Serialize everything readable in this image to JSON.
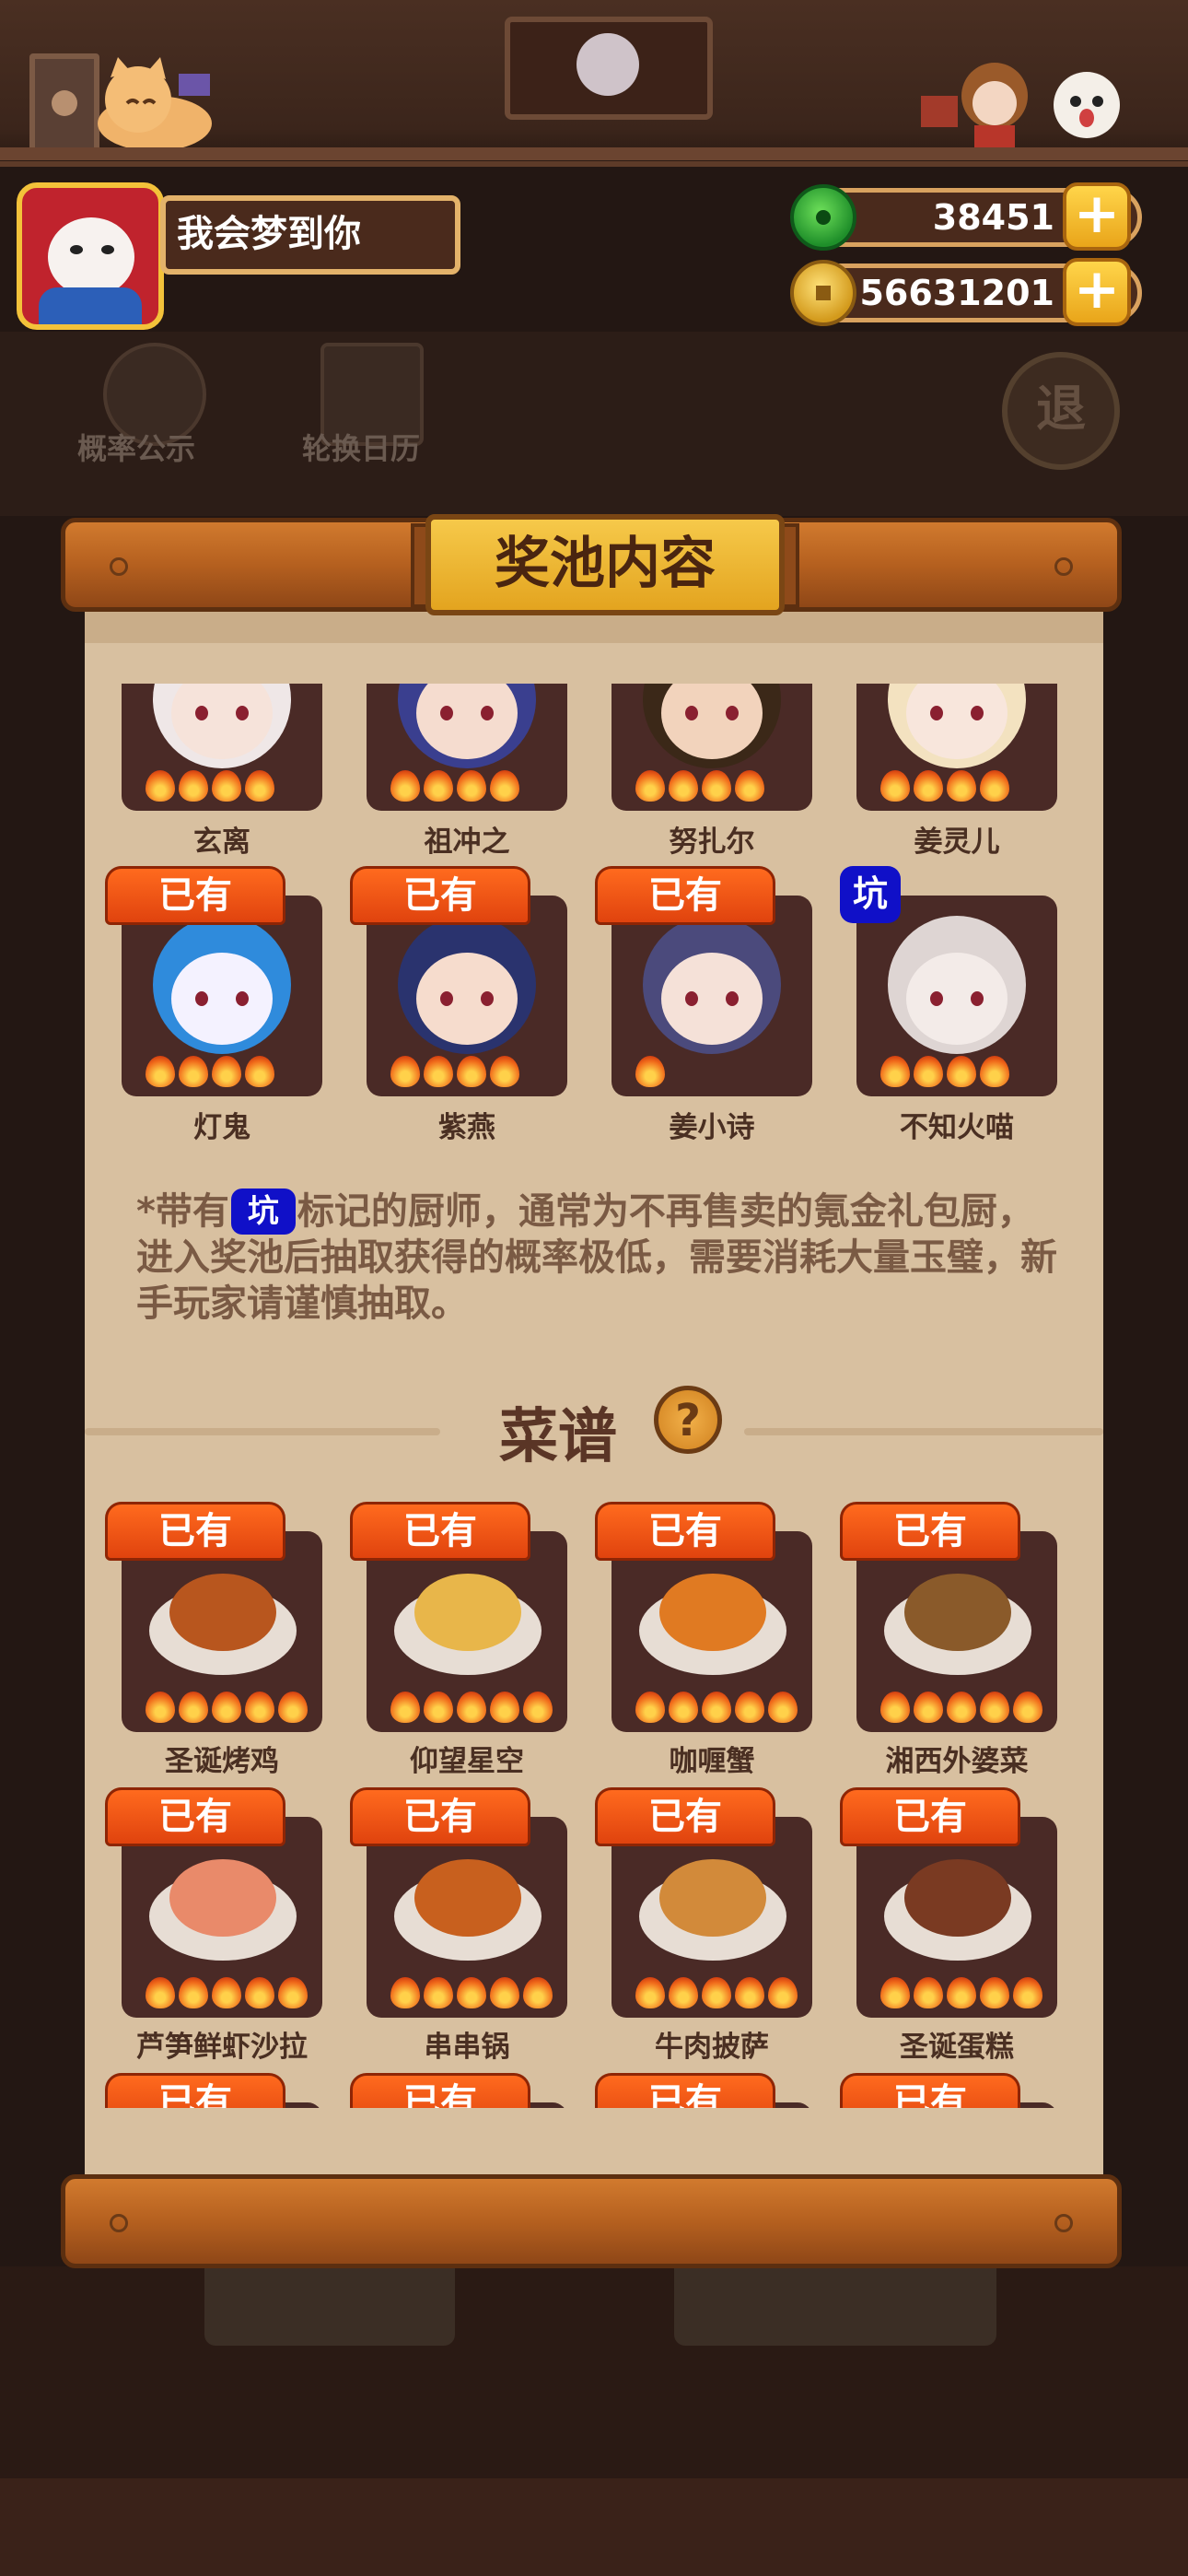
{
  "header": {
    "player_name": "我会梦到你",
    "jade": "38451",
    "gold": "56631201",
    "plus": "+"
  },
  "background": {
    "prob_label": "概率公示",
    "rotation_label": "轮换日历",
    "exit_label": "退"
  },
  "panel": {
    "title": "奖池内容"
  },
  "chefs": [
    {
      "name": "玄离",
      "owned": false,
      "pit": false,
      "stars": 4,
      "hair": "#efe7e7",
      "skin": "#f6e3da"
    },
    {
      "name": "祖冲之",
      "owned": false,
      "pit": false,
      "stars": 4,
      "hair": "#3a3f8f",
      "skin": "#f5dccf"
    },
    {
      "name": "努扎尔",
      "owned": false,
      "pit": false,
      "stars": 4,
      "hair": "#3b2818",
      "skin": "#f2d3bc"
    },
    {
      "name": "姜灵儿",
      "owned": false,
      "pit": false,
      "stars": 4,
      "hair": "#f3e2c0",
      "skin": "#f8e6dc"
    },
    {
      "name": "灯鬼",
      "owned": true,
      "pit": false,
      "stars": 4,
      "hair": "#2f8bdc",
      "skin": "#f4f2ff"
    },
    {
      "name": "紫燕",
      "owned": true,
      "pit": false,
      "stars": 4,
      "hair": "#2a336e",
      "skin": "#f6dccd"
    },
    {
      "name": "姜小诗",
      "owned": true,
      "pit": false,
      "stars": 1,
      "hair": "#4b4a7c",
      "skin": "#f5e1d8"
    },
    {
      "name": "不知火喵",
      "owned": false,
      "pit": true,
      "stars": 4,
      "hair": "#ded5d3",
      "skin": "#f3ebe8"
    }
  ],
  "tags": {
    "owned": "已有",
    "pit": "坑"
  },
  "notice": {
    "before": "*带有",
    "after": "标记的厨师，通常为不再售卖的氪金礼包厨，进入奖池后抽取获得的概率极低，需要消耗大量玉璧，新手玩家请谨慎抽取。"
  },
  "recipes_section": {
    "title": "菜谱",
    "help": "?"
  },
  "recipes": [
    {
      "name": "圣诞烤鸡",
      "owned": true,
      "stars": 5,
      "food": "#b8561e"
    },
    {
      "name": "仰望星空",
      "owned": true,
      "stars": 5,
      "food": "#e8b64a"
    },
    {
      "name": "咖喱蟹",
      "owned": true,
      "stars": 5,
      "food": "#e07a22"
    },
    {
      "name": "湘西外婆菜",
      "owned": true,
      "stars": 5,
      "food": "#8a5a2a"
    },
    {
      "name": "芦笋鲜虾沙拉",
      "owned": true,
      "stars": 5,
      "food": "#e98a6a"
    },
    {
      "name": "串串锅",
      "owned": true,
      "stars": 5,
      "food": "#c8601e"
    },
    {
      "name": "牛肉披萨",
      "owned": true,
      "stars": 5,
      "food": "#d28a3a"
    },
    {
      "name": "圣诞蛋糕",
      "owned": true,
      "stars": 5,
      "food": "#7a3a22"
    },
    {
      "name": "",
      "owned": true,
      "stars": 0,
      "food": "#4a2a26"
    },
    {
      "name": "",
      "owned": true,
      "stars": 0,
      "food": "#4a2a26"
    },
    {
      "name": "",
      "owned": true,
      "stars": 0,
      "food": "#4a2a26"
    },
    {
      "name": "",
      "owned": true,
      "stars": 0,
      "food": "#4a2a26"
    }
  ],
  "colors": {
    "owned_tag": "#e8470f",
    "pit_tag": "#1010c8",
    "card_bg": "#4a2a26",
    "paper": "#d8c0a0"
  }
}
